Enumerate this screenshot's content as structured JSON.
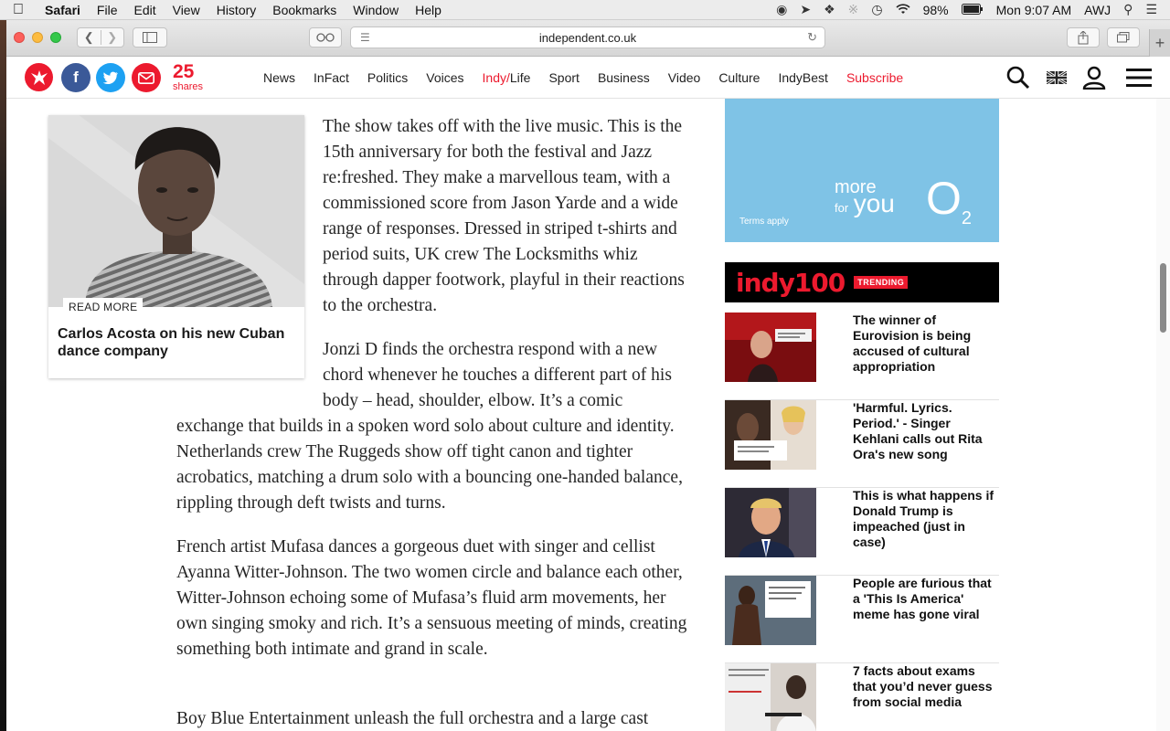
{
  "menubar": {
    "apple": "",
    "app": "Safari",
    "items": [
      "File",
      "Edit",
      "View",
      "History",
      "Bookmarks",
      "Window",
      "Help"
    ],
    "battery": "98%",
    "clock": "Mon 9:07 AM",
    "user": "AWJ"
  },
  "browser": {
    "url": "independent.co.uk",
    "new_tab": "+"
  },
  "header": {
    "share_count": "25",
    "share_label": "shares",
    "nav": [
      "News",
      "InFact",
      "Politics",
      "Voices"
    ],
    "indy_part": "Indy/",
    "life_part": "Life",
    "nav2": [
      "Sport",
      "Business",
      "Video",
      "Culture",
      "IndyBest"
    ],
    "subscribe": "Subscribe",
    "brand_color": "#ec1a2e"
  },
  "read_more": {
    "tag": "READ MORE",
    "title": "Carlos Acosta on his new Cuban dance company"
  },
  "article": {
    "p1": "The show takes off with the live music. This is the 15th anniversary for both the festival and Jazz re:freshed. They make a marvellous team, with a commissioned score from Jason Yarde and a wide range of responses. Dressed in striped t-shirts and period suits, UK crew The Locksmiths whiz through dapper footwork, playful in their reactions to the orchestra.",
    "p2a": "Jonzi D finds the orchestra respond with a new chord whenever he touches a different part of his body – head, shoulder, elbow. It’s a comic",
    "p2b": "exchange that builds in a spoken word solo about culture and identity. Netherlands crew The Ruggeds show off tight canon and tighter acrobatics, matching a drum solo with a bouncing one-handed balance, rippling through deft twists and turns.",
    "p3": "French artist Mufasa dances a gorgeous duet with singer and cellist Ayanna Witter-Johnson. The two women circle and balance each other, Witter-Johnson echoing some of Mufasa’s fluid arm movements, her own singing smoky and rich. It’s a sensuous meeting of minds, creating something both intimate and grand in scale.",
    "p4": "Boy Blue Entertainment unleash the full orchestra and a large cast"
  },
  "ad": {
    "more": "more",
    "for": "for",
    "you": "you",
    "o2": "O",
    "o2_sub": "2",
    "terms": "Terms apply"
  },
  "indy100": {
    "brand": "indy100",
    "trending": "TRENDING",
    "stories": [
      {
        "headline": "The winner of Eurovision is being accused of cultural appropriation"
      },
      {
        "headline": "'Harmful. Lyrics. Period.' - Singer Kehlani calls out Rita Ora's new song"
      },
      {
        "headline": "This is what happens if Donald Trump is impeached (just in case)"
      },
      {
        "headline": "People are furious that a 'This Is America' meme has gone viral"
      },
      {
        "headline": "7 facts about exams that you’d never guess from social media"
      }
    ]
  }
}
